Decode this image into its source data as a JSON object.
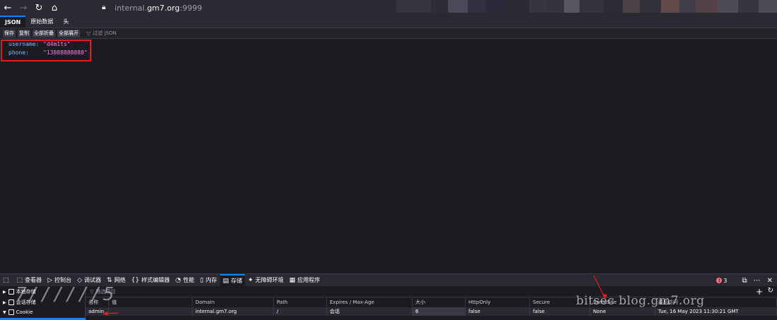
{
  "browser": {
    "url_prefix": "internal.",
    "url_host": "gm7.org",
    "url_suffix": ":9999",
    "blur_colors": [
      "#3b3a44",
      "#4a4856",
      "#2f2f3a",
      "#595767",
      "#3c3b5d",
      "#2a2a3a",
      "#2c2b33",
      "#4d4c55",
      "#3a3942",
      "#6b6a72",
      "#45444d",
      "#2f2e36",
      "#5a4e4a",
      "#3c3b43",
      "#7a5a50",
      "#4a4552",
      "#a0736a",
      "#5c5a62",
      "#3d3c44",
      "#8a8a92"
    ]
  },
  "json_viewer": {
    "tabs": [
      "JSON",
      "原始数据",
      "头"
    ],
    "buttons": [
      "保存",
      "复制",
      "全部折叠",
      "全部展开"
    ],
    "filter_placeholder": "过滤 JSON",
    "rows": [
      {
        "key": "username:",
        "value": "\"d4m1ts\""
      },
      {
        "key": "phone:",
        "value": "\"13888888888\""
      }
    ]
  },
  "devtools": {
    "tabs": [
      {
        "icon": "⬚",
        "label": "查看器"
      },
      {
        "icon": "▷",
        "label": "控制台"
      },
      {
        "icon": "◇",
        "label": "调试器"
      },
      {
        "icon": "⇅",
        "label": "网络"
      },
      {
        "icon": "{}",
        "label": "样式编辑器"
      },
      {
        "icon": "◔",
        "label": "性能"
      },
      {
        "icon": "▯",
        "label": "内存"
      },
      {
        "icon": "▤",
        "label": "存储"
      },
      {
        "icon": "✦",
        "label": "无障碍环境"
      },
      {
        "icon": "▦",
        "label": "应用程序"
      }
    ],
    "active_tab_index": 7,
    "error_count": "3",
    "storage_tree": [
      "本地存储",
      "会话存储",
      "Cookie"
    ],
    "filter_placeholder": "筛选项目",
    "columns": [
      "名称",
      "值",
      "Domain",
      "Path",
      "Expires / Max-Age",
      "大小",
      "HttpOnly",
      "Secure",
      "SameSite",
      "最后访问"
    ],
    "cookie_row": [
      "admin",
      "",
      "internal.gm7.org",
      "/",
      "会话",
      "6",
      "false",
      "false",
      "None",
      "Tue, 16 May 2023 11:30:21 GMT"
    ]
  },
  "watermark_right": "bitsec blog.gm7.org",
  "watermark_left": "7//////5"
}
